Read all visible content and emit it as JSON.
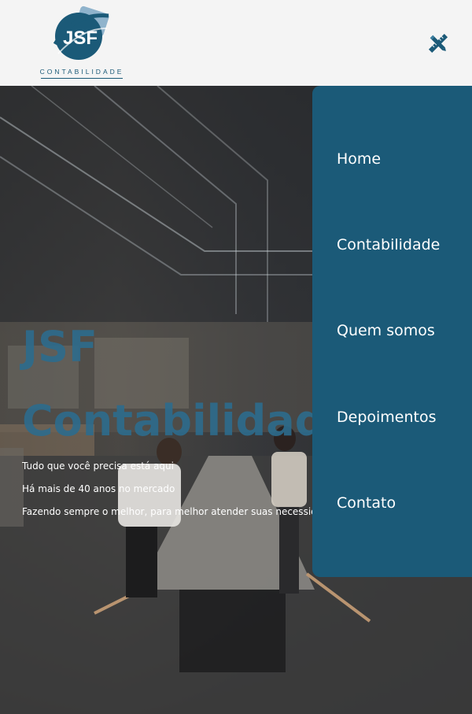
{
  "header": {
    "logo": {
      "mark_text": "JSF",
      "wordmark": "CONTABILIDADE"
    },
    "close_icon": "close-x-pencil-ruler-icon"
  },
  "hero": {
    "title_line1": "JSF",
    "title_line2": "Contabilidade",
    "lines": [
      "Tudo que você precisa está aqui",
      "Há mais de 40 anos no mercado",
      "Fazendo sempre o melhor, para melhor atender suas necessidades"
    ]
  },
  "menu": {
    "items": [
      "Home",
      "Contabilidade",
      "Quem somos",
      "Depoimentos",
      "Contato"
    ]
  },
  "colors": {
    "brand": "#1b5a78",
    "header_bg": "#f4f4f4",
    "title": "#2d6c8d"
  }
}
